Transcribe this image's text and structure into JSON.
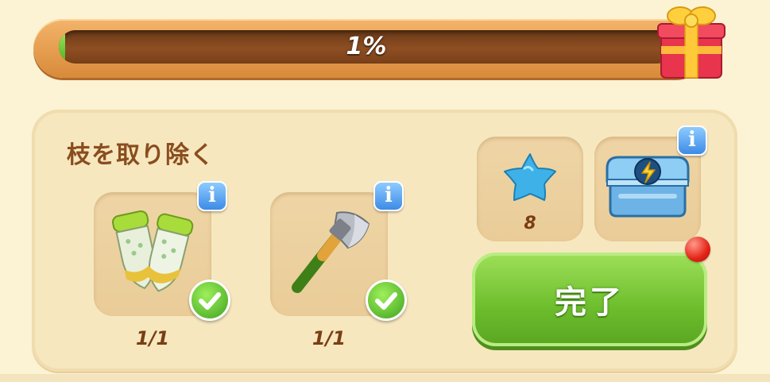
{
  "progress": {
    "percent_label": "1%",
    "fraction": 0.01
  },
  "task": {
    "title": "枝を取り除く",
    "requirements": [
      {
        "icon": "gloves-icon",
        "count": "1/1",
        "completed": true
      },
      {
        "icon": "axe-icon",
        "count": "1/1",
        "completed": true
      }
    ]
  },
  "rewards": [
    {
      "icon": "blue-star-icon",
      "count": "8"
    },
    {
      "icon": "energy-chest-icon",
      "count": ""
    }
  ],
  "complete_button": {
    "label": "完了"
  },
  "info_glyph": "i",
  "colors": {
    "background": "#fbf3d3",
    "progress_fill": "#4fae24",
    "button_green": "#6cbd2c",
    "title_brown": "#8a4d1e",
    "info_blue": "#3d8be6",
    "notification_red": "#e42216"
  }
}
